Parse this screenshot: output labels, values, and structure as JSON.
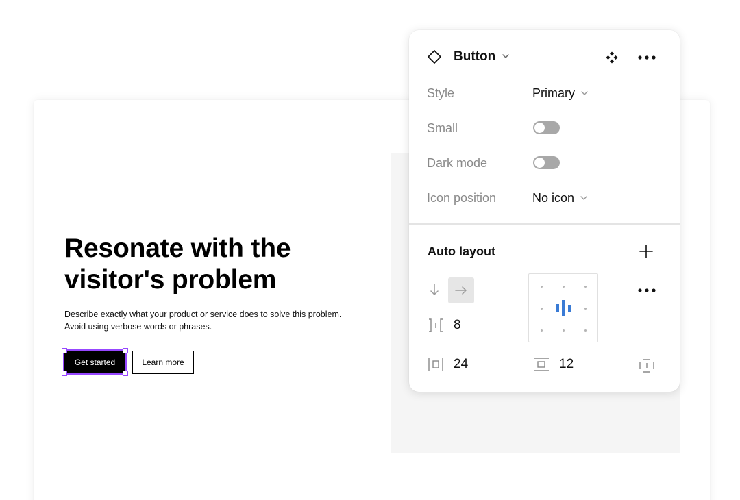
{
  "hero": {
    "title_line1": "Resonate with the",
    "title_line2": "visitor's problem",
    "desc_line1": "Describe exactly what your product or service does to solve this problem.",
    "desc_line2": "Avoid using verbose words or phrases.",
    "primary_button": "Get started",
    "secondary_button": "Learn more"
  },
  "panel": {
    "component_name": "Button",
    "component_icon": "component-diamond-icon",
    "instance_icon": "instance-icon",
    "properties": [
      {
        "label": "Style",
        "type": "dropdown",
        "value": "Primary"
      },
      {
        "label": "Small",
        "type": "toggle",
        "value": false
      },
      {
        "label": "Dark mode",
        "type": "toggle",
        "value": false
      },
      {
        "label": "Icon position",
        "type": "dropdown",
        "value": "No icon"
      }
    ],
    "auto_layout": {
      "title": "Auto layout",
      "direction": "horizontal",
      "gap": "8",
      "horizontal_padding": "24",
      "vertical_padding": "12",
      "alignment": "center"
    }
  },
  "colors": {
    "selection": "#9747ff",
    "align_active": "#3a7bd5",
    "toggle_off": "#a8a8a8"
  }
}
